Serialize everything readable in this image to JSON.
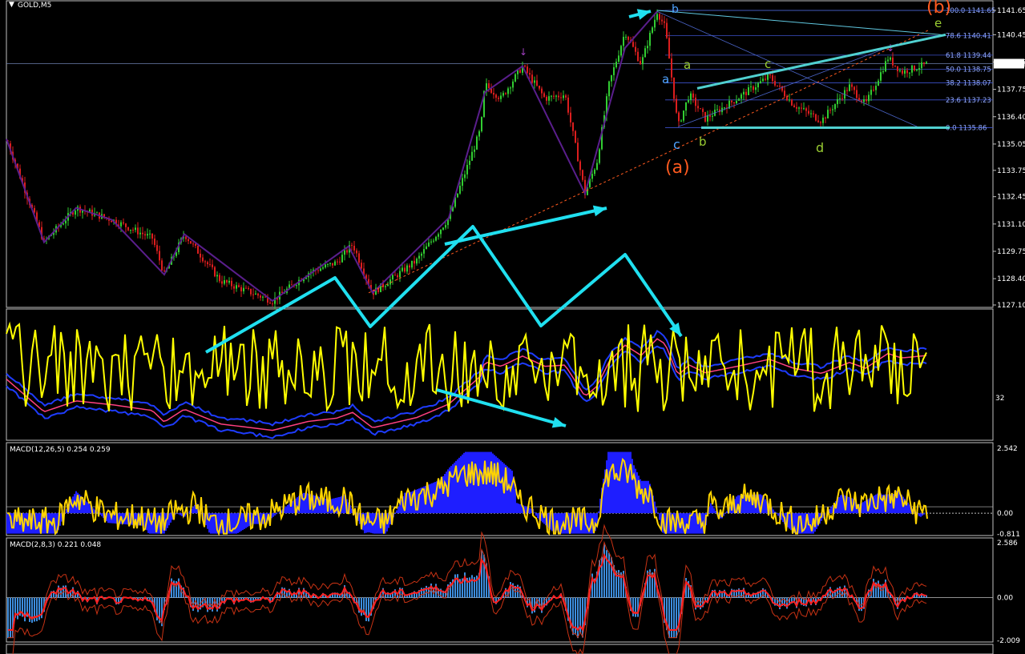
{
  "symbol_title": "GOLD,M5",
  "chart_data": [
    {
      "type": "candlestick",
      "title": "GOLD,M5",
      "yticks": [
        "1141.65",
        "1140.45",
        "1139.10",
        "1137.75",
        "1136.40",
        "1135.05",
        "1133.75",
        "1132.45",
        "1131.10",
        "1129.75",
        "1128.40",
        "1127.10"
      ],
      "ylim": [
        1127.1,
        1141.65
      ],
      "current_price": "1139.02",
      "fib_levels": [
        {
          "label": "100.0",
          "price": "1141.65"
        },
        {
          "label": "78.6",
          "price": "1140.41"
        },
        {
          "label": "61.8",
          "price": "1139.44"
        },
        {
          "label": "50.0",
          "price": "1138.75"
        },
        {
          "label": "38.2",
          "price": "1138.07"
        },
        {
          "label": "23.6",
          "price": "1137.23"
        },
        {
          "label": "0.0",
          "price": "1135.86"
        }
      ],
      "wave_labels": [
        {
          "text": "b",
          "color": "#4fa3ff"
        },
        {
          "text": "a",
          "color": "#4fa3ff"
        },
        {
          "text": "c",
          "color": "#4fa3ff"
        },
        {
          "text": "a",
          "color": "#9acd32"
        },
        {
          "text": "b",
          "color": "#9acd32"
        },
        {
          "text": "c",
          "color": "#9acd32"
        },
        {
          "text": "d",
          "color": "#9acd32"
        },
        {
          "text": "e",
          "color": "#9acd32"
        },
        {
          "text": "(a)",
          "color": "#ff5a1f"
        },
        {
          "text": "(b)",
          "color": "#ff5a1f"
        }
      ],
      "grid": false
    },
    {
      "type": "line",
      "title": "",
      "ytick": "32",
      "grid": false
    },
    {
      "type": "bar",
      "title": "MACD(12,26,5) 0.254 0.259",
      "yticks": [
        "2.542",
        "0.00",
        "-0.811"
      ],
      "grid": false
    },
    {
      "type": "bar",
      "title": "MACD(2,8,3) 0.221 0.048",
      "yticks": [
        "2.586",
        "0.00",
        "-2.009"
      ],
      "grid": false
    }
  ],
  "colors": {
    "background": "#000000",
    "bull_candle": "#32cd32",
    "bear_candle": "#dc1e1e",
    "zigzag": "#5a1e8c",
    "arrows": "#20e0f0",
    "rsi": "#ffff00",
    "bands": "#1e3cff",
    "macd_hist": "#1e1eff",
    "macd_signal": "#ffd400"
  }
}
